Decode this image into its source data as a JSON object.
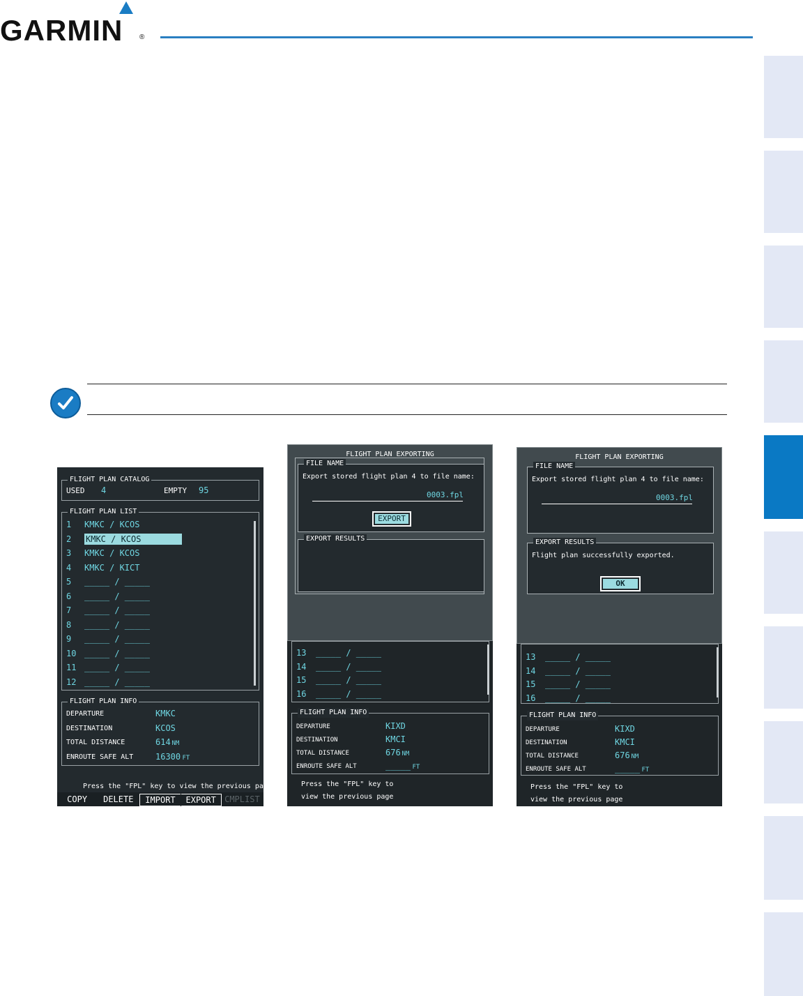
{
  "header": {
    "brand": "GARMIN",
    "registered_mark": "®",
    "rule_color": "#2a7fc1",
    "logo_mark_color": "#1a7cc4"
  },
  "side_tabs": {
    "count": 10,
    "active_index": 4,
    "tab_color": "#e3e8f5",
    "active_color": "#0a79c4"
  },
  "note": {
    "icon": "note-check-icon"
  },
  "screen1": {
    "catalog": {
      "title": "FLIGHT PLAN CATALOG",
      "used_label": "USED",
      "used_value": "4",
      "empty_label": "EMPTY",
      "empty_value": "95"
    },
    "list": {
      "title": "FLIGHT PLAN LIST",
      "selected_index": 1,
      "rows": [
        {
          "num": "1",
          "route": "KMKC / KCOS"
        },
        {
          "num": "2",
          "route": "KMKC / KCOS"
        },
        {
          "num": "3",
          "route": "KMKC / KCOS"
        },
        {
          "num": "4",
          "route": "KMKC / KICT"
        },
        {
          "num": "5",
          "route": "_____ / _____"
        },
        {
          "num": "6",
          "route": "_____ / _____"
        },
        {
          "num": "7",
          "route": "_____ / _____"
        },
        {
          "num": "8",
          "route": "_____ / _____"
        },
        {
          "num": "9",
          "route": "_____ / _____"
        },
        {
          "num": "10",
          "route": "_____ / _____"
        },
        {
          "num": "11",
          "route": "_____ / _____"
        },
        {
          "num": "12",
          "route": "_____ / _____"
        }
      ]
    },
    "info": {
      "title": "FLIGHT PLAN INFO",
      "rows": [
        {
          "label": "DEPARTURE",
          "value": "KMKC",
          "unit": ""
        },
        {
          "label": "DESTINATION",
          "value": "KCOS",
          "unit": ""
        },
        {
          "label": "TOTAL DISTANCE",
          "value": "614",
          "unit": "NM"
        },
        {
          "label": "ENROUTE SAFE ALT",
          "value": "16300",
          "unit": "FT"
        }
      ]
    },
    "footer_hint": "Press the \"FPL\" key to view the previous page",
    "softkeys": [
      "COPY",
      "DELETE",
      "IMPORT",
      "EXPORT",
      "CMPLIST"
    ]
  },
  "screen2": {
    "dialog_title": "FLIGHT PLAN EXPORTING",
    "file_name": {
      "title": "FILE NAME",
      "prompt": "Export stored flight plan 4 to file name:",
      "value": "0003.fpl"
    },
    "export_button": "EXPORT",
    "results": {
      "title": "EXPORT RESULTS",
      "message": ""
    },
    "list_rows": [
      {
        "num": "13",
        "route": "_____ / _____"
      },
      {
        "num": "14",
        "route": "_____ / _____"
      },
      {
        "num": "15",
        "route": "_____ / _____"
      },
      {
        "num": "16",
        "route": "_____ / _____"
      }
    ],
    "info": {
      "title": "FLIGHT PLAN INFO",
      "rows": [
        {
          "label": "DEPARTURE",
          "value": "KIXD",
          "unit": ""
        },
        {
          "label": "DESTINATION",
          "value": "KMCI",
          "unit": ""
        },
        {
          "label": "TOTAL DISTANCE",
          "value": "676",
          "unit": "NM"
        },
        {
          "label": "ENROUTE SAFE ALT",
          "value": "_____",
          "unit": "FT"
        }
      ]
    },
    "footer_line1": "Press the \"FPL\" key to",
    "footer_line2": "view the previous page"
  },
  "screen3": {
    "dialog_title": "FLIGHT PLAN EXPORTING",
    "file_name": {
      "title": "FILE NAME",
      "prompt": "Export stored flight plan 4 to file name:",
      "value": "0003.fpl"
    },
    "results": {
      "title": "EXPORT RESULTS",
      "message": "Flight plan successfully exported."
    },
    "ok_button": "OK",
    "list_rows": [
      {
        "num": "13",
        "route": "_____ / _____"
      },
      {
        "num": "14",
        "route": "_____ / _____"
      },
      {
        "num": "15",
        "route": "_____ / _____"
      },
      {
        "num": "16",
        "route": "_____ / _____"
      }
    ],
    "info": {
      "title": "FLIGHT PLAN INFO",
      "rows": [
        {
          "label": "DEPARTURE",
          "value": "KIXD",
          "unit": ""
        },
        {
          "label": "DESTINATION",
          "value": "KMCI",
          "unit": ""
        },
        {
          "label": "TOTAL DISTANCE",
          "value": "676",
          "unit": "NM"
        },
        {
          "label": "ENROUTE SAFE ALT",
          "value": "_____",
          "unit": "FT"
        }
      ]
    },
    "footer_line1": "Press the \"FPL\" key to",
    "footer_line2": "view the previous page"
  }
}
